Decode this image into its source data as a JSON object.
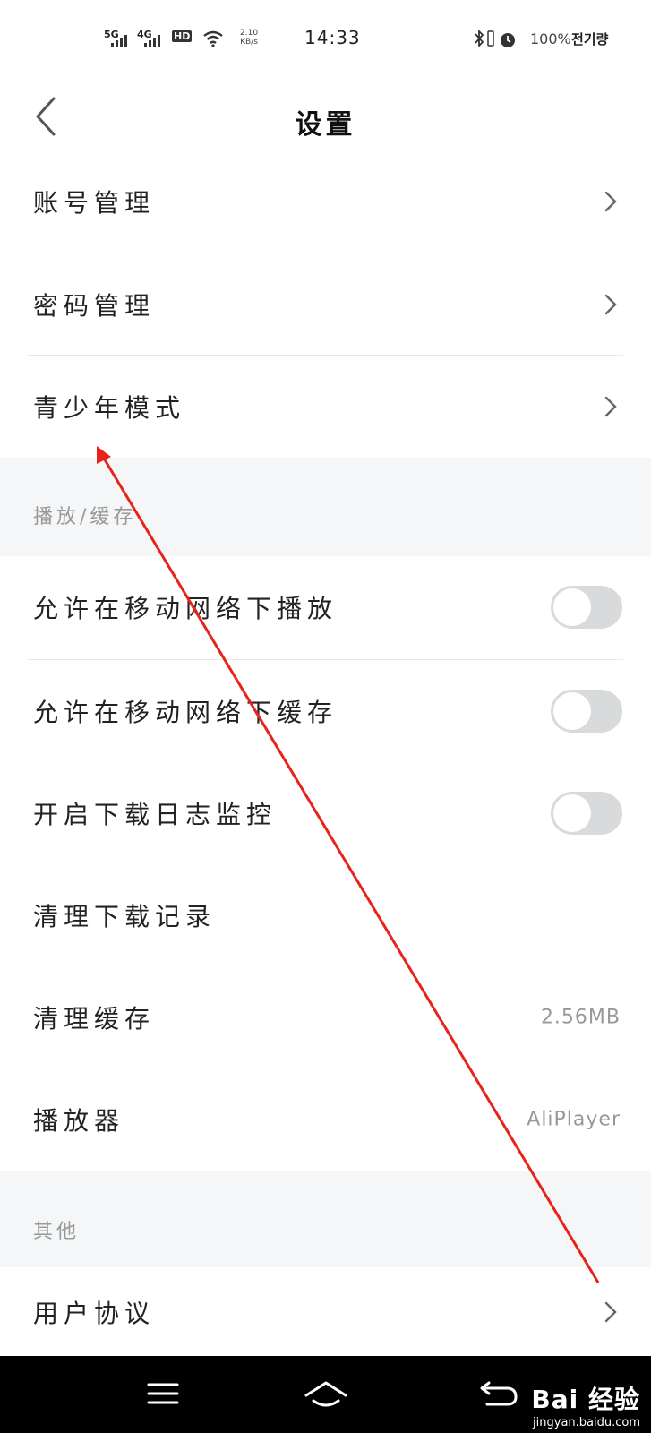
{
  "status_bar": {
    "signal_1": "5G",
    "signal_2": "4G",
    "hd": "HD",
    "net_speed_value": "2.10",
    "net_speed_unit": "KB/s",
    "time": "14:33",
    "battery": "100%",
    "carrier": "전기량",
    "icons": [
      "bluetooth-icon",
      "vibrate-icon",
      "alarm-icon",
      "wifi-icon"
    ]
  },
  "header": {
    "title": "设置",
    "back_icon": "chevron-left-icon"
  },
  "account_section": {
    "items": [
      {
        "label": "账号管理"
      },
      {
        "label": "密码管理"
      },
      {
        "label": "青少年模式"
      }
    ]
  },
  "playback_section": {
    "title": "播放/缓存",
    "toggles": [
      {
        "label": "允许在移动网络下播放",
        "on": false
      },
      {
        "label": "允许在移动网络下缓存",
        "on": false
      },
      {
        "label": "开启下载日志监控",
        "on": false
      }
    ],
    "clear_download": {
      "label": "清理下载记录"
    },
    "clear_cache": {
      "label": "清理缓存",
      "value": "2.56MB"
    },
    "player": {
      "label": "播放器",
      "value": "AliPlayer"
    }
  },
  "other_section": {
    "title": "其他",
    "items": [
      {
        "label": "用户协议"
      }
    ]
  },
  "nav_bar": {
    "icons": [
      "menu-icon",
      "home-icon",
      "back-icon"
    ]
  },
  "watermark": {
    "brand": "Bai 经验",
    "url": "jingyan.baidu.com"
  },
  "colors": {
    "annotation_arrow": "#e8231b",
    "section_bg": "#f5f6f8",
    "toggle_off": "#d9dadc"
  }
}
